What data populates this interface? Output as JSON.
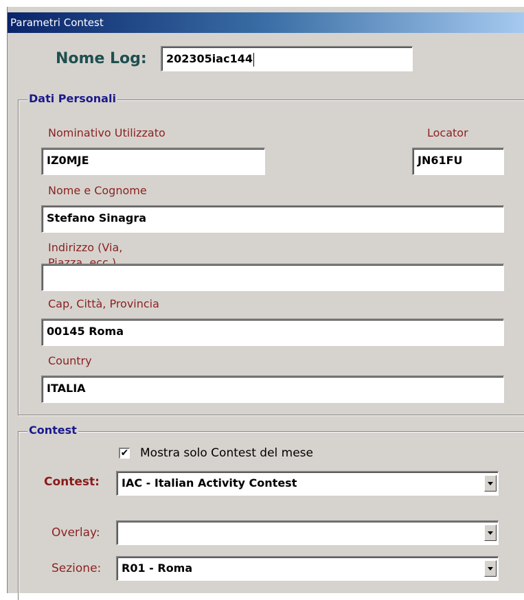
{
  "window": {
    "title": "Parametri Contest"
  },
  "log": {
    "label": "Nome Log:",
    "value": "202305iac144"
  },
  "personal": {
    "group_label": "Dati Personali",
    "callsign_label": "Nominativo Utilizzato",
    "callsign_value": "IZ0MJE",
    "locator_label": "Locator",
    "locator_value": "JN61FU",
    "name_label": "Nome e Cognome",
    "name_value": "Stefano Sinagra",
    "address_label": "Indirizzo (Via, Piazza, ecc.)",
    "address_value": "",
    "city_label": "Cap, Città, Provincia",
    "city_value": "00145 Roma",
    "country_label": "Country",
    "country_value": "ITALIA"
  },
  "contest": {
    "group_label": "Contest",
    "month_only_checkbox_label": "Mostra solo Contest del mese",
    "month_only_checked": true,
    "contest_label": "Contest:",
    "contest_value": "IAC - Italian Activity Contest",
    "overlay_label": "Overlay:",
    "overlay_value": "",
    "section_label": "Sezione:",
    "section_value": "R01 - Roma"
  },
  "colors": {
    "window_bg": "#d6d3ce",
    "titlebar_start": "#0a246a",
    "titlebar_end": "#a6caf0",
    "field_label_red": "#8b2222",
    "group_label_blue": "#1a1a8c",
    "nome_log_label": "#1f4f4f"
  },
  "icons": {
    "checkbox_check": "check-icon",
    "dropdown_arrow": "chevron-down-icon"
  }
}
